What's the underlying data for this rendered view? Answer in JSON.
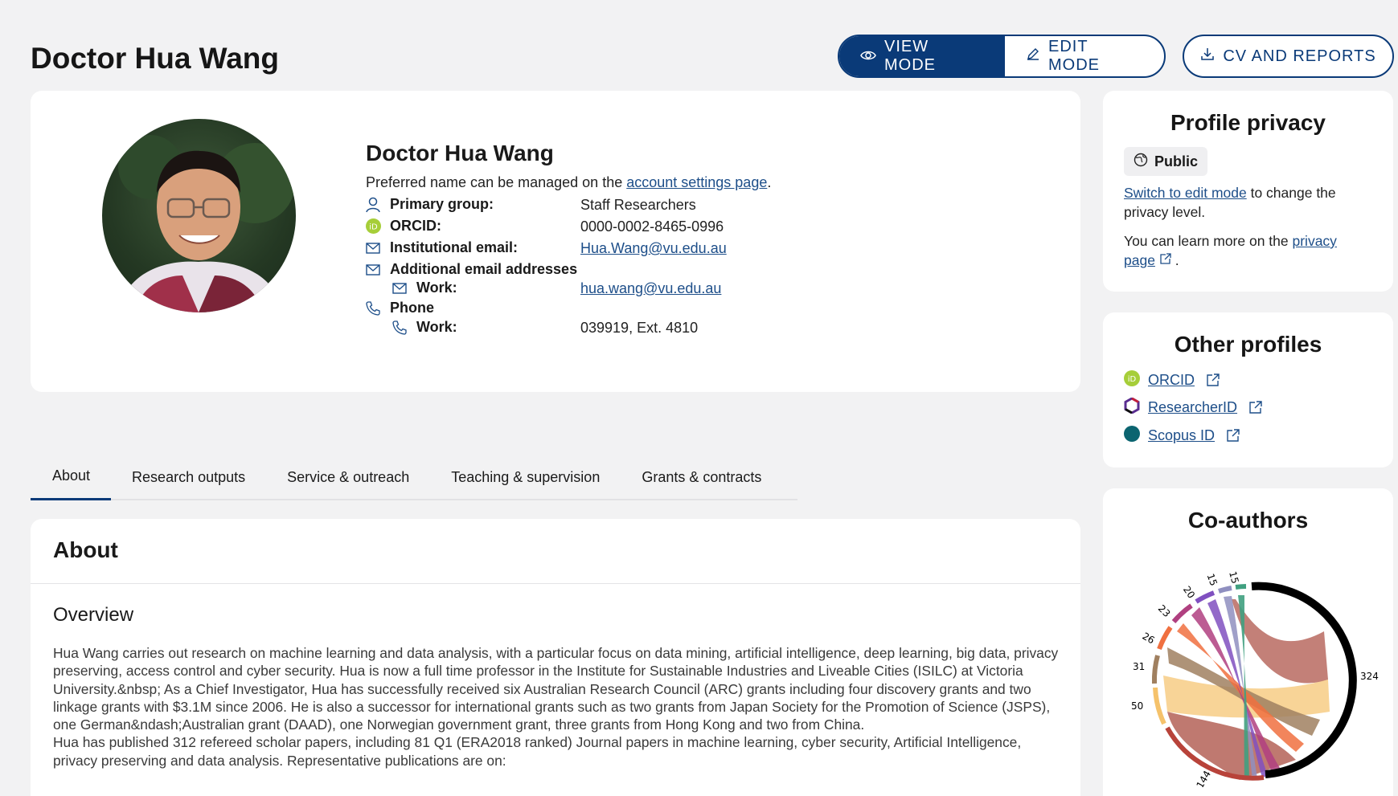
{
  "page": {
    "title": "Doctor Hua Wang"
  },
  "header": {
    "view_mode": "VIEW MODE",
    "edit_mode": "EDIT MODE",
    "cv_reports": "CV AND REPORTS"
  },
  "profile": {
    "name": "Doctor Hua Wang",
    "note_prefix": "Preferred name can be managed on the ",
    "note_link": "account settings page",
    "note_suffix": ".",
    "primary_group_label": "Primary group:",
    "primary_group_value": "Staff Researchers",
    "orcid_label": "ORCID:",
    "orcid_value": "0000-0002-8465-0996",
    "inst_email_label": "Institutional email:",
    "inst_email_value": "Hua.Wang@vu.edu.au",
    "additional_email_label": "Additional email addresses",
    "work_label": "Work:",
    "work_email_value": "hua.wang@vu.edu.au",
    "phone_label": "Phone",
    "phone_work_label": "Work:",
    "phone_work_value": "039919, Ext. 4810"
  },
  "tabs": [
    "About",
    "Research outputs",
    "Service & outreach",
    "Teaching & supervision",
    "Grants & contracts"
  ],
  "about": {
    "heading": "About",
    "overview_heading": "Overview",
    "paragraph1": "Hua Wang carries out research on machine learning and data analysis, with a particular focus on data mining, artificial intelligence, deep learning, big data, privacy preserving, access control and cyber security. Hua is now a full time professor in the Institute for Sustainable Industries and Liveable Cities (ISILC) at Victoria University.&nbsp; As a Chief Investigator, Hua has successfully received six Australian Research Council (ARC) grants including four discovery grants and two linkage grants with $3.1M since 2006. He is also a successor for international grants such as two grants from Japan Society for the Promotion of Science (JSPS), one German&ndash;Australian grant (DAAD), one Norwegian government grant, three grants from Hong Kong and two from China.",
    "paragraph2": "Hua has published 312 refereed scholar papers, including 81 Q1 (ERA2018 ranked) Journal papers in machine learning, cyber security, Artificial Intelligence, privacy preserving and data analysis. Representative publications are on:"
  },
  "privacy": {
    "title": "Profile privacy",
    "level": "Public",
    "switch_link": "Switch to edit mode",
    "switch_suffix": " to change the privacy level.",
    "learn_prefix": "You can learn more on the ",
    "learn_link_1": "privacy",
    "learn_link_2": "page",
    "learn_suffix": "."
  },
  "other_profiles": {
    "title": "Other profiles",
    "items": [
      {
        "label": "ORCID",
        "color": "#a6ce39"
      },
      {
        "label": "ResearcherID",
        "color": "#5a2d91"
      },
      {
        "label": "Scopus ID",
        "color": "#0b6470"
      }
    ]
  },
  "coauthors": {
    "title": "Co-authors",
    "main_label": "324",
    "labels": [
      "144",
      "50",
      "31",
      "26",
      "23",
      "20",
      "15",
      "15"
    ]
  },
  "colors": {
    "brand": "#0a3a78",
    "link": "#1d4e89"
  }
}
